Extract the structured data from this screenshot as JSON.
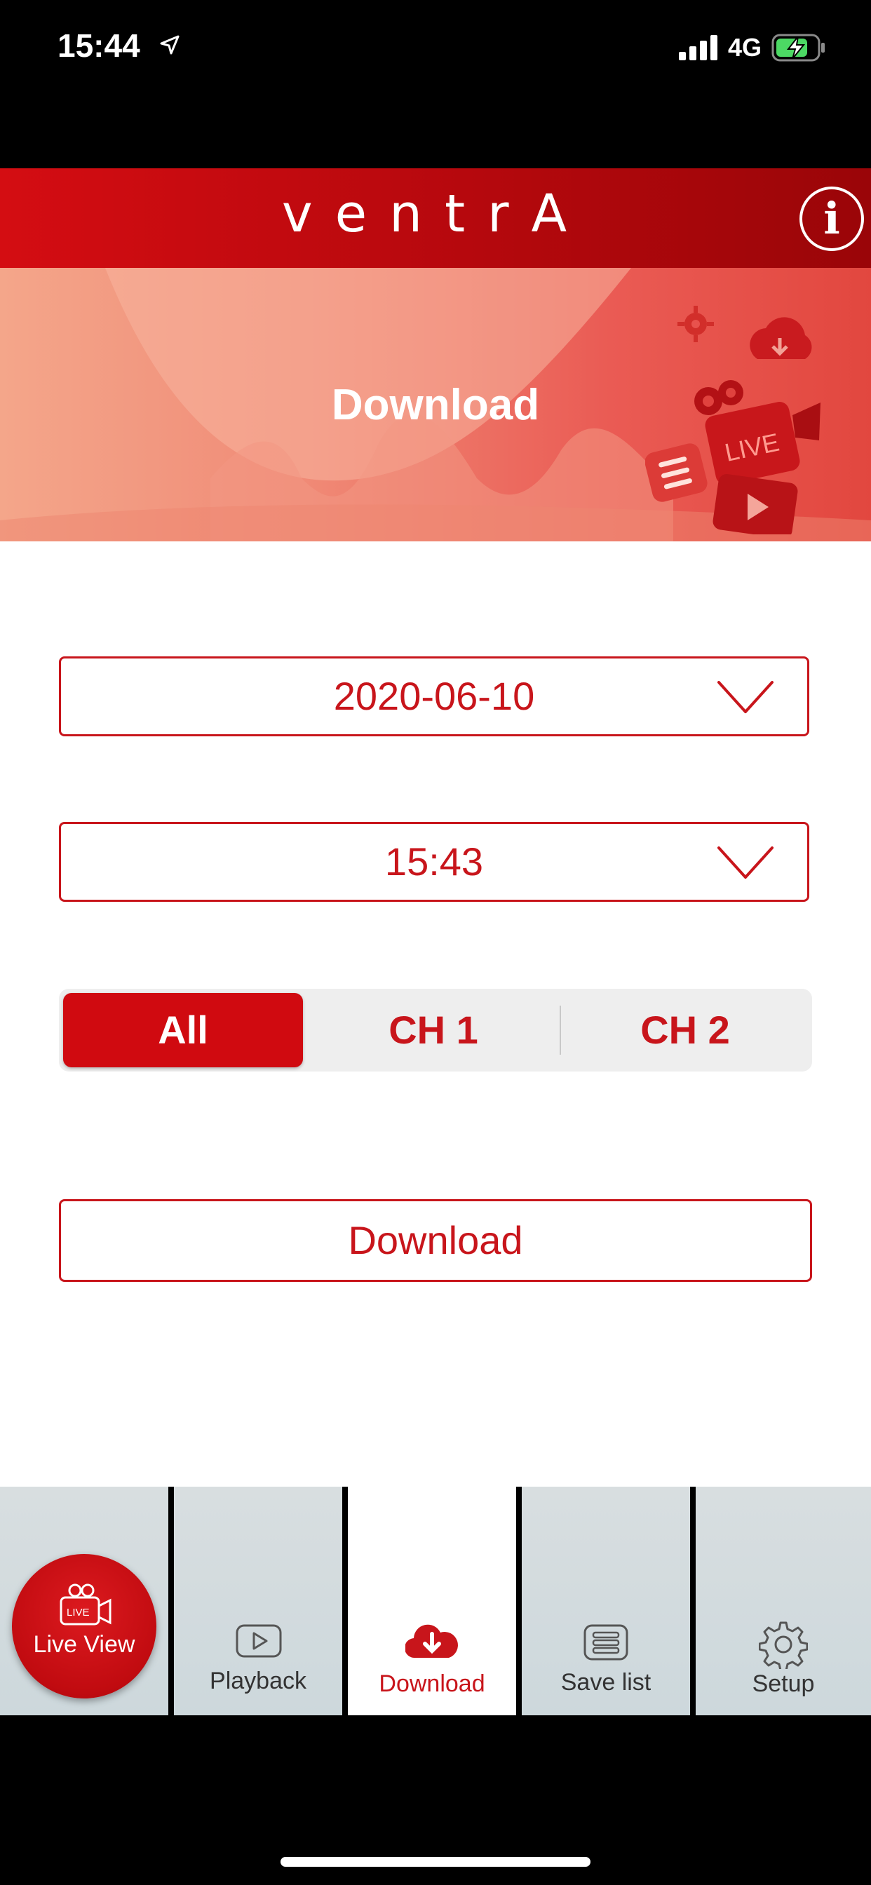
{
  "status_bar": {
    "time": "15:44",
    "network": "4G"
  },
  "header": {
    "brand": "ventrA"
  },
  "banner": {
    "title": "Download",
    "badge": "LIVE"
  },
  "form": {
    "date_value": "2020-06-10",
    "time_value": "15:43",
    "channels": [
      "All",
      "CH 1",
      "CH 2"
    ],
    "selected_channel": "All",
    "download_label": "Download"
  },
  "tabbar": {
    "tabs": [
      {
        "label": "Live View",
        "icon": "live-camera-icon",
        "badge": "LIVE"
      },
      {
        "label": "Playback",
        "icon": "play-icon"
      },
      {
        "label": "Download",
        "icon": "cloud-download-icon"
      },
      {
        "label": "Save list",
        "icon": "list-icon"
      },
      {
        "label": "Setup",
        "icon": "gear-icon"
      }
    ],
    "active": "Download"
  },
  "colors": {
    "accent": "#c8151b",
    "header_red": "#d40d12",
    "tab_bg": "#d3dbde"
  }
}
